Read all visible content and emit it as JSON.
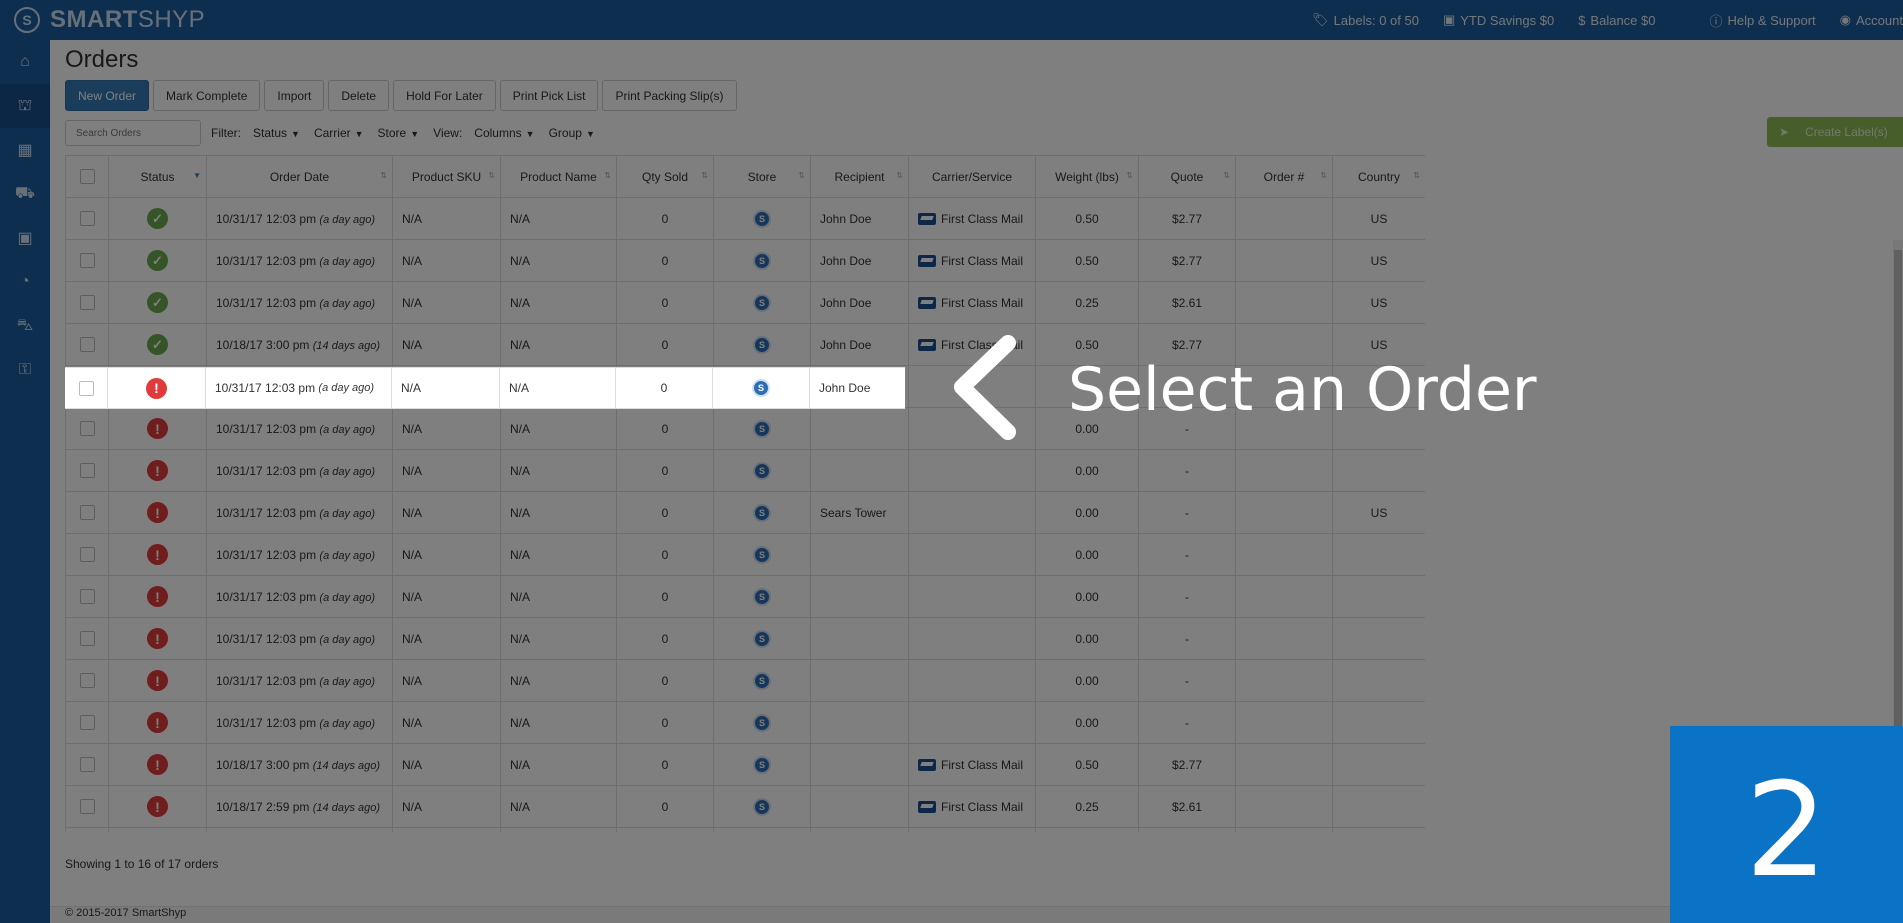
{
  "app": {
    "brand_bold": "SMART",
    "brand_light": "SHYP",
    "logo_letter": "S"
  },
  "topbar": {
    "labels": "Labels: 0 of 50",
    "ytd_savings": "YTD Savings $0",
    "balance": "Balance $0",
    "help": "Help & Support",
    "account": "Account"
  },
  "sidebar": {
    "items": [
      {
        "icon": "home-icon",
        "glyph": "⌂"
      },
      {
        "icon": "basket-icon",
        "glyph": "🧺"
      },
      {
        "icon": "calendar-icon",
        "glyph": "▦"
      },
      {
        "icon": "truck-icon",
        "glyph": "⛟"
      },
      {
        "icon": "address-book-icon",
        "glyph": "▣"
      },
      {
        "icon": "pie-chart-icon",
        "glyph": "◔"
      },
      {
        "icon": "cart-icon",
        "glyph": "🛒"
      },
      {
        "icon": "lock-icon",
        "glyph": "🔒"
      }
    ]
  },
  "page": {
    "title": "Orders",
    "showing": "Showing 1 to 16 of 17 orders",
    "footer": "© 2015-2017 SmartShyp"
  },
  "toolbar": {
    "new_order": "New Order",
    "mark_complete": "Mark Complete",
    "import": "Import",
    "delete": "Delete",
    "hold_for_later": "Hold For Later",
    "print_pick_list": "Print Pick List",
    "print_packing_slips": "Print Packing Slip(s)"
  },
  "filters": {
    "search_placeholder": "Search Orders",
    "filter_label": "Filter:",
    "status": "Status",
    "carrier": "Carrier",
    "store": "Store",
    "view_label": "View:",
    "columns": "Columns",
    "group": "Group",
    "create_labels": "Create Label(s)"
  },
  "table": {
    "headers": [
      "Status",
      "Order Date",
      "Product SKU",
      "Product Name",
      "Qty Sold",
      "Store",
      "Recipient",
      "Carrier/Service",
      "Weight (lbs)",
      "Quote",
      "Order #",
      "Country"
    ],
    "rows": [
      {
        "status": "ok",
        "date": "10/31/17 12:03 pm",
        "ago": "(a day ago)",
        "sku": "N/A",
        "name": "N/A",
        "qty": "0",
        "recipient": "John Doe",
        "carrier": "First Class Mail",
        "weight": "0.50",
        "quote": "$2.77",
        "order": "",
        "country": "US"
      },
      {
        "status": "ok",
        "date": "10/31/17 12:03 pm",
        "ago": "(a day ago)",
        "sku": "N/A",
        "name": "N/A",
        "qty": "0",
        "recipient": "John Doe",
        "carrier": "First Class Mail",
        "weight": "0.50",
        "quote": "$2.77",
        "order": "",
        "country": "US"
      },
      {
        "status": "ok",
        "date": "10/31/17 12:03 pm",
        "ago": "(a day ago)",
        "sku": "N/A",
        "name": "N/A",
        "qty": "0",
        "recipient": "John Doe",
        "carrier": "First Class Mail",
        "weight": "0.25",
        "quote": "$2.61",
        "order": "",
        "country": "US"
      },
      {
        "status": "ok",
        "date": "10/18/17 3:00 pm",
        "ago": "(14 days ago)",
        "sku": "N/A",
        "name": "N/A",
        "qty": "0",
        "recipient": "John Doe",
        "carrier": "First Class Mail",
        "weight": "0.50",
        "quote": "$2.77",
        "order": "",
        "country": "US"
      },
      {
        "status": "err",
        "date": "10/31/17 12:03 pm",
        "ago": "(a day ago)",
        "sku": "N/A",
        "name": "N/A",
        "qty": "0",
        "recipient": "John Doe",
        "carrier": "",
        "weight": "",
        "quote": "",
        "order": "",
        "country": ""
      },
      {
        "status": "err",
        "date": "10/31/17 12:03 pm",
        "ago": "(a day ago)",
        "sku": "N/A",
        "name": "N/A",
        "qty": "0",
        "recipient": "",
        "carrier": "",
        "weight": "0.00",
        "quote": "-",
        "order": "",
        "country": ""
      },
      {
        "status": "err",
        "date": "10/31/17 12:03 pm",
        "ago": "(a day ago)",
        "sku": "N/A",
        "name": "N/A",
        "qty": "0",
        "recipient": "",
        "carrier": "",
        "weight": "0.00",
        "quote": "-",
        "order": "",
        "country": ""
      },
      {
        "status": "err",
        "date": "10/31/17 12:03 pm",
        "ago": "(a day ago)",
        "sku": "N/A",
        "name": "N/A",
        "qty": "0",
        "recipient": "Sears Tower",
        "carrier": "",
        "weight": "0.00",
        "quote": "-",
        "order": "",
        "country": "US"
      },
      {
        "status": "err",
        "date": "10/31/17 12:03 pm",
        "ago": "(a day ago)",
        "sku": "N/A",
        "name": "N/A",
        "qty": "0",
        "recipient": "",
        "carrier": "",
        "weight": "0.00",
        "quote": "-",
        "order": "",
        "country": ""
      },
      {
        "status": "err",
        "date": "10/31/17 12:03 pm",
        "ago": "(a day ago)",
        "sku": "N/A",
        "name": "N/A",
        "qty": "0",
        "recipient": "",
        "carrier": "",
        "weight": "0.00",
        "quote": "-",
        "order": "",
        "country": ""
      },
      {
        "status": "err",
        "date": "10/31/17 12:03 pm",
        "ago": "(a day ago)",
        "sku": "N/A",
        "name": "N/A",
        "qty": "0",
        "recipient": "",
        "carrier": "",
        "weight": "0.00",
        "quote": "-",
        "order": "",
        "country": ""
      },
      {
        "status": "err",
        "date": "10/31/17 12:03 pm",
        "ago": "(a day ago)",
        "sku": "N/A",
        "name": "N/A",
        "qty": "0",
        "recipient": "",
        "carrier": "",
        "weight": "0.00",
        "quote": "-",
        "order": "",
        "country": ""
      },
      {
        "status": "err",
        "date": "10/31/17 12:03 pm",
        "ago": "(a day ago)",
        "sku": "N/A",
        "name": "N/A",
        "qty": "0",
        "recipient": "",
        "carrier": "",
        "weight": "0.00",
        "quote": "-",
        "order": "",
        "country": ""
      },
      {
        "status": "err",
        "date": "10/18/17 3:00 pm",
        "ago": "(14 days ago)",
        "sku": "N/A",
        "name": "N/A",
        "qty": "0",
        "recipient": "",
        "carrier": "First Class Mail",
        "weight": "0.50",
        "quote": "$2.77",
        "order": "",
        "country": ""
      },
      {
        "status": "err",
        "date": "10/18/17 2:59 pm",
        "ago": "(14 days ago)",
        "sku": "N/A",
        "name": "N/A",
        "qty": "0",
        "recipient": "",
        "carrier": "First Class Mail",
        "weight": "0.25",
        "quote": "$2.61",
        "order": "",
        "country": ""
      },
      {
        "status": "err",
        "date": "",
        "ago": "",
        "sku": "",
        "name": "",
        "qty": "",
        "recipient": "",
        "carrier": "",
        "weight": "",
        "quote": "",
        "order": "",
        "country": ""
      }
    ]
  },
  "overlay": {
    "callout": "Select an Order",
    "step": "2"
  },
  "colors": {
    "brand_blue": "#1b5c9e",
    "primary_button": "#337ab7",
    "status_ok": "#6aa84f",
    "status_error": "#e03a3a",
    "create_labels_green": "#8fbd54",
    "step_badge": "#0b73c6"
  }
}
